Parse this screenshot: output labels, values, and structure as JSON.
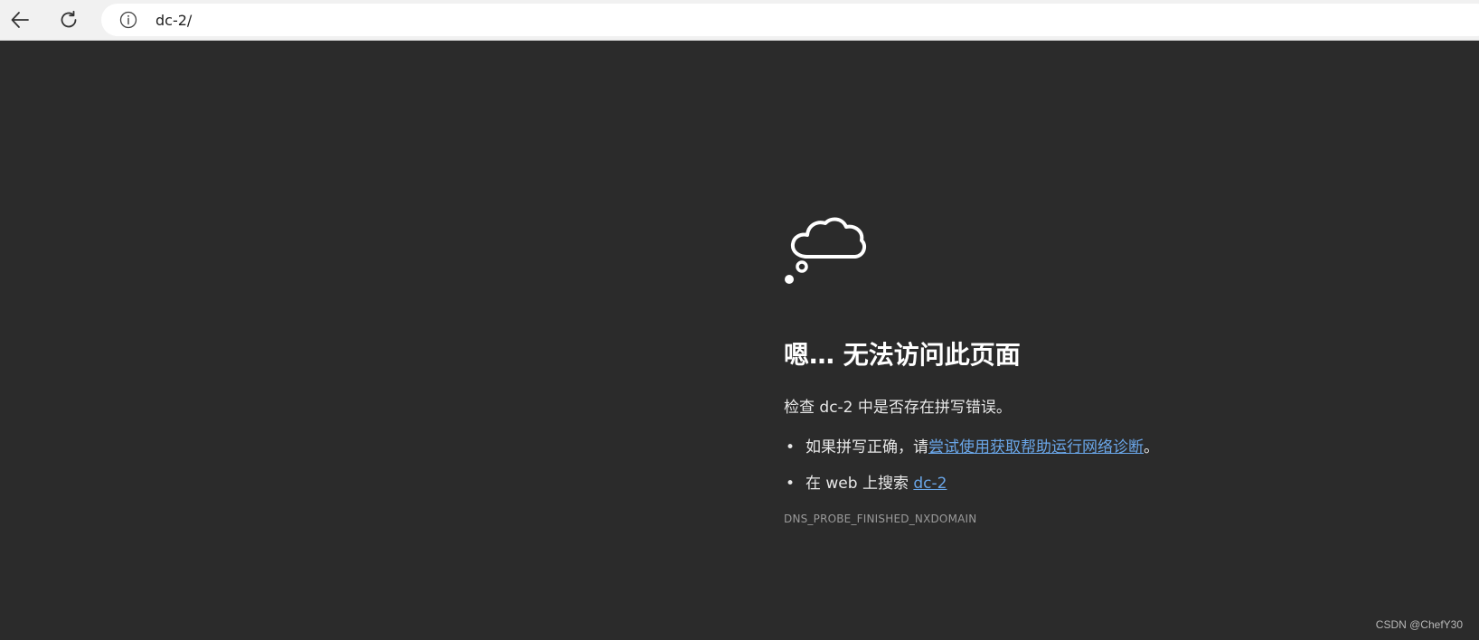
{
  "browser": {
    "url": "dc-2/",
    "icons": {
      "back": "back-arrow-icon",
      "refresh": "refresh-icon",
      "info": "info-icon"
    }
  },
  "error_page": {
    "icon": "thought-cloud-icon",
    "heading": "嗯… 无法访问此页面",
    "check_text": "检查 dc-2 中是否存在拼写错误。",
    "suggestions": [
      {
        "prefix": "如果拼写正确，请",
        "link": "尝试使用获取帮助运行网络诊断",
        "suffix": "。"
      },
      {
        "prefix": "在 web 上搜索 ",
        "link": "dc-2",
        "suffix": ""
      }
    ],
    "bullet": "•",
    "error_code": "DNS_PROBE_FINISHED_NXDOMAIN"
  },
  "watermark": "CSDN @ChefY30",
  "colors": {
    "background": "#2b2b2b",
    "link": "#6aa6e8",
    "toolbar": "#f1f1f1"
  }
}
